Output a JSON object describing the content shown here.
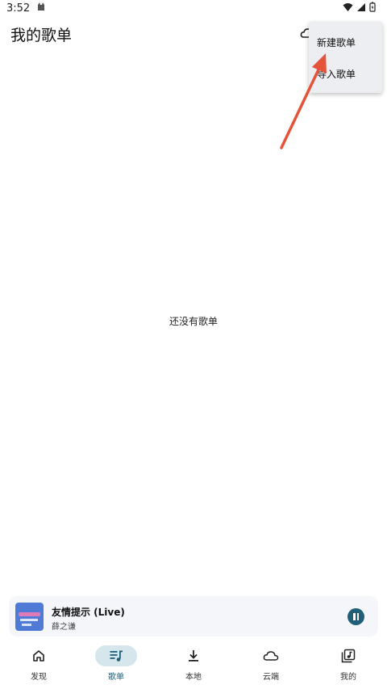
{
  "status_bar": {
    "time": "3:52"
  },
  "header": {
    "title": "我的歌单",
    "cloud_icon": "cloud-icon"
  },
  "menu": {
    "items": [
      {
        "label": "新建歌单"
      },
      {
        "label": "导入歌单"
      }
    ]
  },
  "annotation": {
    "arrow_color": "#e5533a"
  },
  "main": {
    "empty_text": "还没有歌单"
  },
  "player": {
    "title": "友情提示 (Live)",
    "artist": "薛之谦",
    "state_icon": "pause-icon",
    "accent": "#1f5f78"
  },
  "nav": {
    "items": [
      {
        "label": "发现",
        "icon": "home-icon"
      },
      {
        "label": "歌单",
        "icon": "playlist-icon",
        "active": true
      },
      {
        "label": "本地",
        "icon": "download-icon"
      },
      {
        "label": "云端",
        "icon": "cloud-icon"
      },
      {
        "label": "我的",
        "icon": "library-icon"
      }
    ]
  }
}
